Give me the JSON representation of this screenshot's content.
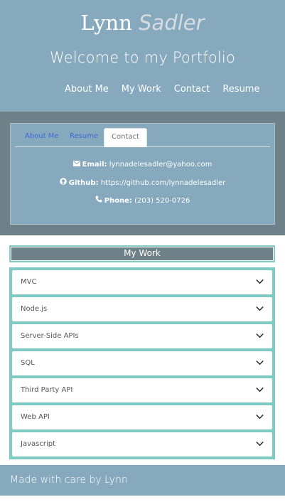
{
  "header": {
    "first_name": "Lynn",
    "last_name": "Sadler",
    "subtitle": "Welcome to my Portfolio",
    "nav": [
      "About Me",
      "My Work",
      "Contact",
      "Resume"
    ]
  },
  "contact": {
    "tabs": [
      "About Me",
      "Resume",
      "Contact"
    ],
    "active_tab": "Contact",
    "email_label": "Email:",
    "email": "lynnadelesadler@yahoo.com",
    "github_label": "Github:",
    "github": "https://github.com/lynnadelesadler",
    "phone_label": "Phone:",
    "phone": "(203) 520-0726"
  },
  "work": {
    "heading": "My Work",
    "items": [
      "MVC",
      "Node.js",
      "Server-Side APIs",
      "SQL",
      "Third Party API",
      "Web API",
      "Javascript"
    ]
  },
  "footer": {
    "text": "Made with care by Lynn"
  },
  "icons": {
    "email": "envelope-icon",
    "github": "github-icon",
    "phone": "phone-icon",
    "accordion": "chevron-down-icon"
  },
  "colors": {
    "header_bg": "#86a9be",
    "contact_bg": "#6e8189",
    "accent_teal": "#7fcbc4",
    "tab_link": "#3f6ad8"
  }
}
